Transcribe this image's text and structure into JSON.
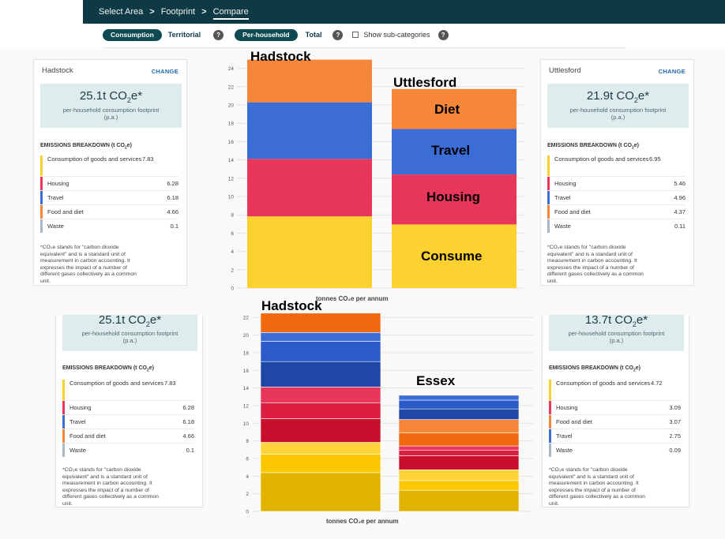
{
  "breadcrumb": [
    "Select Area",
    "Footprint",
    "Compare"
  ],
  "breadcrumb_sep": ">",
  "controls": {
    "consumption": "Consumption",
    "territorial": "Territorial",
    "per_household": "Per-household",
    "total": "Total",
    "show_sub": "Show sub-categories",
    "help": "?"
  },
  "top_left": {
    "area": "Hadstock",
    "change": "CHANGE",
    "value": "25.1t CO",
    "value_sub": "2",
    "value_tail": "e*",
    "sub1": "per-household consumption footprint",
    "sub2": "(p.a.)",
    "heading": "EMISSIONS BREAKDOWN (t CO",
    "heading_sub": "2",
    "heading_tail": "e)",
    "rows": [
      {
        "label": "Consumption of goods and services",
        "value": "7.83",
        "color": "#f9d030"
      },
      {
        "label": "Housing",
        "value": "6.28",
        "color": "#e8375a"
      },
      {
        "label": "Travel",
        "value": "6.18",
        "color": "#3c6cd6"
      },
      {
        "label": "Food and diet",
        "value": "4.66",
        "color": "#f6863a"
      },
      {
        "label": "Waste",
        "value": "0.1",
        "color": "#a9b7c6"
      }
    ],
    "note": [
      "*CO₂e stands for \"carbon dioxide",
      "equivalent\" and is a standard unit of",
      "measurement in carbon accounting. It",
      "expresses the impact of a number of",
      "different gases collectively as a common",
      "unit."
    ]
  },
  "top_right": {
    "area": "Uttlesford",
    "change": "CHANGE",
    "value": "21.9t CO",
    "value_sub": "2",
    "value_tail": "e*",
    "sub1": "per-household consumption footprint",
    "sub2": "(p.a.)",
    "heading": "EMISSIONS BREAKDOWN (t CO",
    "heading_sub": "2",
    "heading_tail": "e)",
    "rows": [
      {
        "label": "Consumption of goods and services",
        "value": "6.95",
        "color": "#f9d030"
      },
      {
        "label": "Housing",
        "value": "5.46",
        "color": "#e8375a"
      },
      {
        "label": "Travel",
        "value": "4.96",
        "color": "#3c6cd6"
      },
      {
        "label": "Food and diet",
        "value": "4.37",
        "color": "#f6863a"
      },
      {
        "label": "Waste",
        "value": "0.11",
        "color": "#a9b7c6"
      }
    ],
    "note": [
      "*CO₂e stands for \"carbon dioxide",
      "equivalent\" and is a standard unit of",
      "measurement in carbon accounting. It",
      "expresses the impact of a number of",
      "different gases collectively as a common",
      "unit."
    ]
  },
  "bottom_left": {
    "value": "25.1t CO",
    "value_sub": "2",
    "value_tail": "e*",
    "sub1": "per-household consumption footprint",
    "sub2": "(p.a.)",
    "heading": "EMISSIONS BREAKDOWN (t CO",
    "heading_sub": "2",
    "heading_tail": "e)",
    "rows": [
      {
        "label": "Consumption of goods and services",
        "value": "7.83",
        "color": "#f9d030"
      },
      {
        "label": "Housing",
        "value": "6.28",
        "color": "#e8375a"
      },
      {
        "label": "Travel",
        "value": "6.18",
        "color": "#3c6cd6"
      },
      {
        "label": "Food and diet",
        "value": "4.66",
        "color": "#f6863a"
      },
      {
        "label": "Waste",
        "value": "0.1",
        "color": "#a9b7c6"
      }
    ],
    "note": [
      "*CO₂e stands for \"carbon dioxide",
      "equivalent\" and is a standard unit of",
      "measurement in carbon accounting. It",
      "expresses the impact of a number of",
      "different gases collectively as a common",
      "unit."
    ]
  },
  "bottom_right": {
    "value": "13.7t CO",
    "value_sub": "2",
    "value_tail": "e*",
    "sub1": "per-household consumption footprint",
    "sub2": "(p.a.)",
    "heading": "EMISSIONS BREAKDOWN (t CO",
    "heading_sub": "2",
    "heading_tail": "e)",
    "rows": [
      {
        "label": "Consumption of goods and services",
        "value": "4.72",
        "color": "#f9d030"
      },
      {
        "label": "Housing",
        "value": "3.09",
        "color": "#e8375a"
      },
      {
        "label": "Food and diet",
        "value": "3.07",
        "color": "#f6863a"
      },
      {
        "label": "Travel",
        "value": "2.75",
        "color": "#3c6cd6"
      },
      {
        "label": "Waste",
        "value": "0.09",
        "color": "#a9b7c6"
      }
    ],
    "note": [
      "*CO₂e stands for \"carbon dioxide",
      "equivalent\" and is a standard unit of",
      "measurement in carbon accounting. It",
      "expresses the impact of a number of",
      "different gases collectively as a common",
      "unit."
    ]
  },
  "overlays": {
    "top_hadstock": "Hadstock",
    "top_uttlesford": "Uttlesford",
    "diet": "Diet",
    "travel": "Travel",
    "housing": "Housing",
    "consume": "Consume",
    "bottom_hadstock": "Hadstock",
    "bottom_essex": "Essex"
  },
  "chart_data": [
    {
      "type": "bar",
      "stacked": true,
      "categories": [
        "Hadstock",
        "Uttlesford"
      ],
      "xlabel": "tonnes CO₂e per annum",
      "ylim": [
        0,
        25
      ],
      "yticks": [
        0,
        2,
        4,
        6,
        8,
        10,
        12,
        14,
        16,
        18,
        20,
        22,
        24
      ],
      "series": [
        {
          "name": "Consume",
          "color": "#fcd130",
          "values": [
            7.83,
            6.95
          ]
        },
        {
          "name": "Housing",
          "color": "#e8375a",
          "values": [
            6.28,
            5.46
          ]
        },
        {
          "name": "Travel",
          "color": "#3c6cd6",
          "values": [
            6.18,
            4.96
          ]
        },
        {
          "name": "Diet",
          "color": "#f6863a",
          "values": [
            4.66,
            4.37
          ]
        }
      ]
    },
    {
      "type": "bar",
      "stacked": true,
      "categories": [
        "Hadstock",
        "Essex"
      ],
      "xlabel": "tonnes CO₂e per annum",
      "ylim": [
        0,
        22.2
      ],
      "yticks": [
        0,
        2,
        4,
        6,
        8,
        10,
        12,
        14,
        16,
        18,
        20,
        22
      ],
      "series": [
        {
          "name": "",
          "color": "#e0b400",
          "values": [
            4.4,
            2.4
          ]
        },
        {
          "name": "",
          "color": "#fbc700",
          "values": [
            2.1,
            1.1
          ]
        },
        {
          "name": "",
          "color": "#ffd43b",
          "values": [
            1.33,
            1.22
          ]
        },
        {
          "name": "",
          "color": "#c8102e",
          "values": [
            2.7,
            1.6
          ]
        },
        {
          "name": "",
          "color": "#dc1e41",
          "values": [
            1.8,
            0.6
          ]
        },
        {
          "name": "",
          "color": "#e8375a",
          "values": [
            1.78,
            0.5
          ]
        },
        {
          "name": "",
          "color": "#f26a0f",
          "values": [
            0,
            1.5
          ]
        },
        {
          "name": "",
          "color": "#f6863a",
          "values": [
            0,
            1.5
          ]
        },
        {
          "name": "",
          "color": "#1f47a8",
          "values": [
            2.88,
            1.2
          ]
        },
        {
          "name": "",
          "color": "#2c5ac7",
          "values": [
            2.3,
            1.0
          ]
        },
        {
          "name": "",
          "color": "#3c6cd6",
          "values": [
            1.0,
            0.55
          ]
        },
        {
          "name": "",
          "color": "#f26a0f",
          "values": [
            2.2,
            0
          ]
        }
      ]
    }
  ]
}
